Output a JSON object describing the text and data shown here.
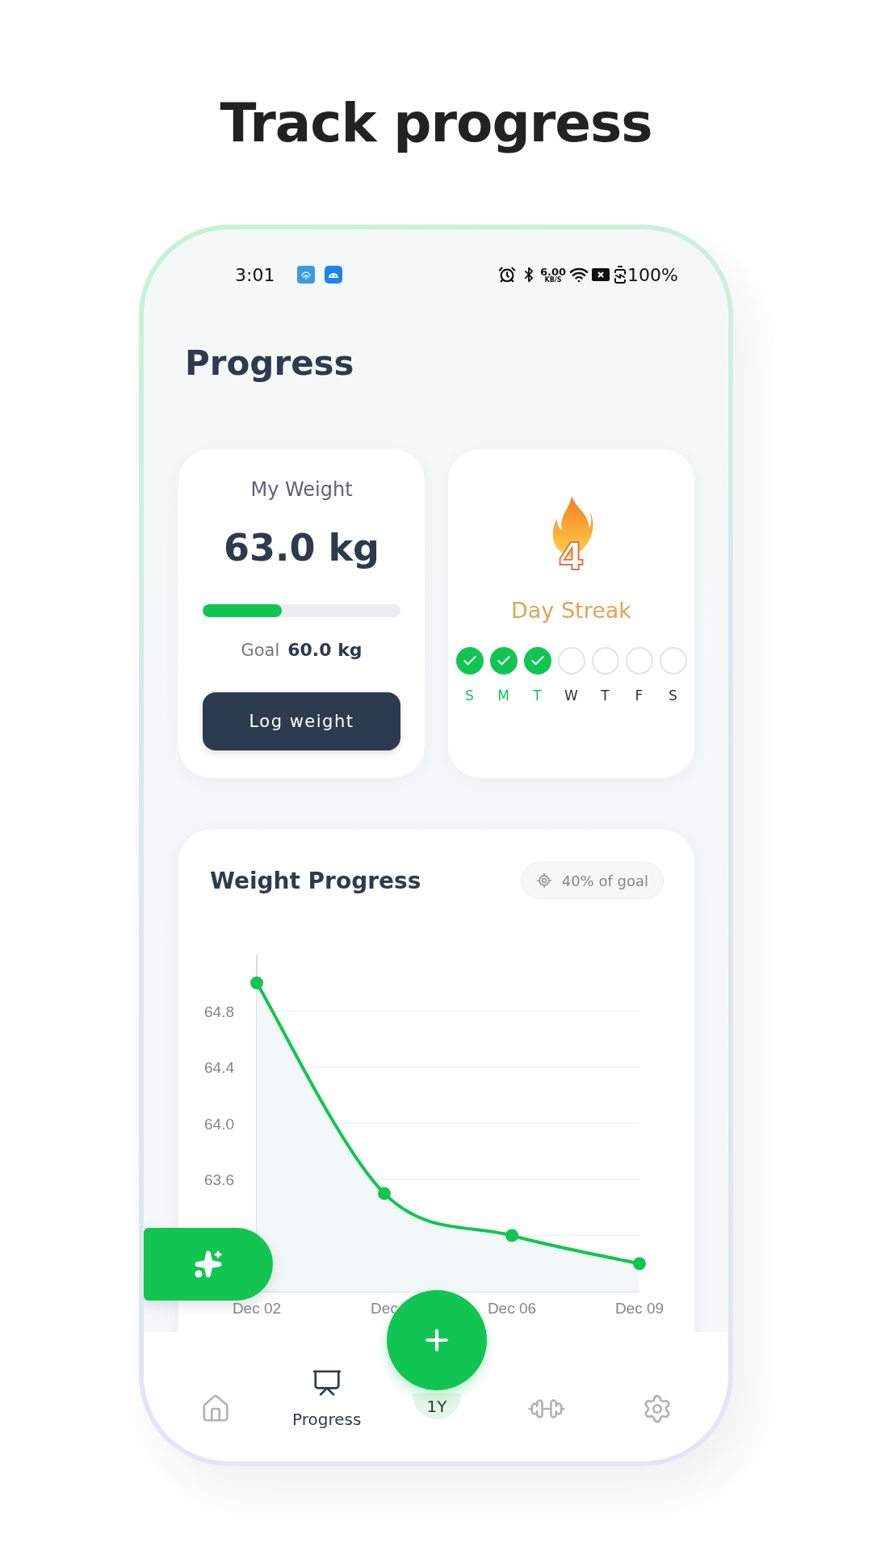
{
  "headline": "Track progress",
  "status_bar": {
    "time": "3:01",
    "net_speed": "6.00",
    "net_unit": "KB/S",
    "battery": "100%"
  },
  "page_title": "Progress",
  "weight_card": {
    "title": "My Weight",
    "value": "63.0 kg",
    "goal_progress": {
      "level": 0.4
    },
    "goal_label": "Goal",
    "goal_value": "60.0 kg",
    "button": "Log weight"
  },
  "streak_card": {
    "count": "4",
    "label": "Day Streak",
    "days": [
      {
        "letter": "S",
        "checked": true
      },
      {
        "letter": "M",
        "checked": true
      },
      {
        "letter": "T",
        "checked": true
      },
      {
        "letter": "W",
        "checked": false
      },
      {
        "letter": "T",
        "checked": false
      },
      {
        "letter": "F",
        "checked": false
      },
      {
        "letter": "S",
        "checked": false
      }
    ]
  },
  "chart_card": {
    "title": "Weight Progress",
    "badge": "40% of goal",
    "chart_data": {
      "type": "area",
      "categories": [
        "Dec 02",
        "Dec",
        "Dec 06",
        "Dec 09"
      ],
      "series": [
        {
          "color": "#12c553",
          "values": [
            65.0,
            63.5,
            63.2,
            63.0
          ]
        }
      ],
      "ylim": [
        62.8,
        65.2
      ],
      "yticks": [
        {
          "value": 63.6,
          "label": "63.6"
        },
        {
          "value": 64,
          "label": "64.0"
        },
        {
          "value": 64.4,
          "label": "64.4"
        },
        {
          "value": 64.8,
          "label": "64.8"
        }
      ],
      "grid": true
    }
  },
  "period": {
    "label": "1Y",
    "selected": true
  },
  "nav": {
    "items": [
      {
        "kind": "home",
        "selected": false
      },
      {
        "kind": "progress",
        "label": "Progress",
        "selected": true
      },
      {
        "kind": "workout",
        "selected": false
      },
      {
        "kind": "settings",
        "selected": false
      }
    ]
  }
}
